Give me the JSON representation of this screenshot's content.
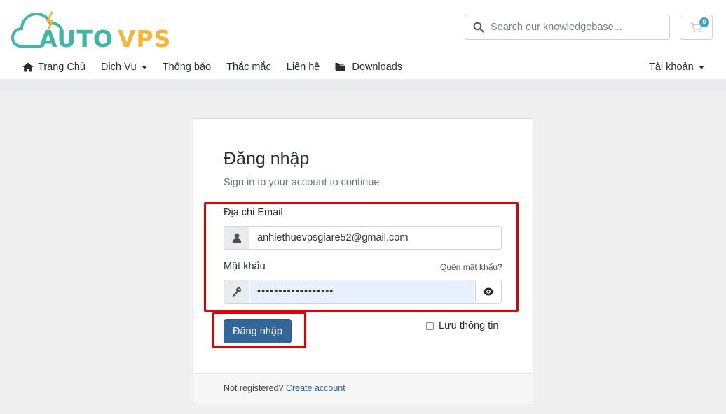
{
  "logo": {
    "part1": "AUTO",
    "part2": "VPS"
  },
  "search": {
    "placeholder": "Search our knowledgebase...",
    "icon": "search-icon"
  },
  "cart": {
    "count": "0",
    "icon": "cart-icon"
  },
  "nav": {
    "items": [
      {
        "label": "Trang Chủ",
        "icon": "home-icon"
      },
      {
        "label": "Dịch Vụ",
        "dropdown": true
      },
      {
        "label": "Thông báo"
      },
      {
        "label": "Thắc mắc"
      },
      {
        "label": "Liên hệ"
      },
      {
        "label": "Downloads",
        "icon": "folder-icon"
      }
    ],
    "account": "Tài khoản"
  },
  "login": {
    "title": "Đăng nhập",
    "subtitle": "Sign in to your account to continue.",
    "email_label": "Địa chỉ Email",
    "email_value": "anhlethuevpsgiare52@gmail.com",
    "password_label": "Mật khẩu",
    "password_value": "••••••••••••••••••",
    "forgot": "Quên mật khẩu?",
    "submit": "Đăng nhập",
    "remember": "Lưu thông tin"
  },
  "footer": {
    "text": "Not registered?",
    "link": "Create account"
  },
  "colors": {
    "teal": "#3fb6a6",
    "gold": "#f3b53a",
    "primary": "#336699",
    "highlight": "#e10000"
  }
}
